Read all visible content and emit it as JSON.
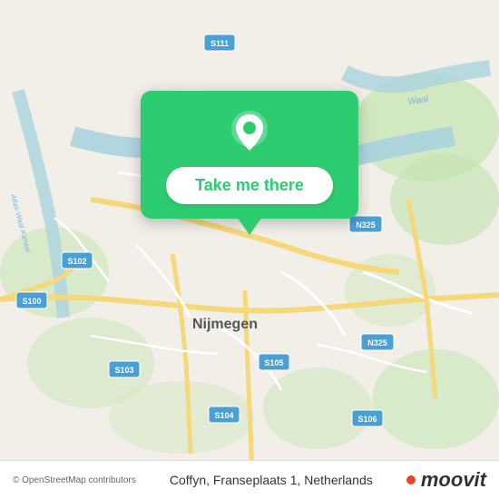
{
  "map": {
    "background_color": "#f2efe9",
    "road_color": "#ffffff",
    "water_color": "#aad3df",
    "green_color": "#c8e6b5"
  },
  "popup": {
    "button_label": "Take me there",
    "background_color": "#2ecc71",
    "button_text_color": "#2ecc71"
  },
  "bottom_bar": {
    "attribution": "© OpenStreetMap contributors",
    "address": "Coffyn, Franseplaats 1, Netherlands",
    "brand": "moovit"
  },
  "road_labels": {
    "s111": "S111",
    "s100_top": "S100",
    "s100_left": "S100",
    "s102": "S102",
    "s103": "S103",
    "s104": "S104",
    "s105": "S105",
    "s106": "S106",
    "n325_top": "N325",
    "n325_bottom": "N325",
    "waal": "Waal",
    "nijmegen": "Nijmegen",
    "atlas_waal_kanaal": "Atlas-Waal Kanaal"
  }
}
